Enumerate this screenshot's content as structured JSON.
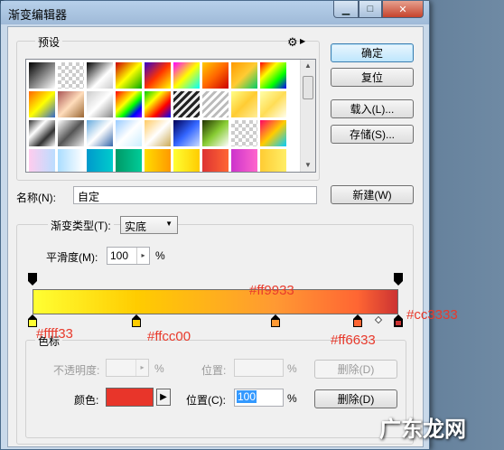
{
  "window": {
    "title": "渐变编辑器",
    "min_glyph": "▁",
    "max_glyph": "□",
    "close_glyph": "✕"
  },
  "presets": {
    "label": "预设",
    "gear_glyph": "⚙"
  },
  "buttons": {
    "ok": "确定",
    "reset": "复位",
    "load": "载入(L)...",
    "save": "存储(S)...",
    "new": "新建(W)"
  },
  "name": {
    "label": "名称(N):",
    "value": "自定"
  },
  "gradient_type": {
    "label": "渐变类型(T):",
    "value": "实底"
  },
  "smoothness": {
    "label": "平滑度(M):",
    "value": "100",
    "unit": "%"
  },
  "stops_group": {
    "label": "色标",
    "opacity_label": "不透明度:",
    "opacity_unit": "%",
    "position_label_dis": "位置:",
    "position_unit_dis": "%",
    "delete_dis": "删除(D)",
    "color_label": "颜色:",
    "position_label": "位置(C):",
    "position_value": "100",
    "position_unit": "%",
    "delete": "删除(D)",
    "current_color": "#e8352a"
  },
  "gradient_stops": [
    {
      "color": "#ffff33",
      "location": 0
    },
    {
      "color": "#ffcc00",
      "location": 28.5
    },
    {
      "color": "#ff9933",
      "location": 66.5
    },
    {
      "color": "#ff6633",
      "location": 89
    },
    {
      "color": "#cc3333",
      "location": 100
    }
  ],
  "annotations": {
    "a1": "#ffff33",
    "a2": "#ffcc00",
    "a3": "#ff9933",
    "a4": "#ff6633",
    "a5": "#cc3333"
  },
  "watermark": "广东龙网"
}
